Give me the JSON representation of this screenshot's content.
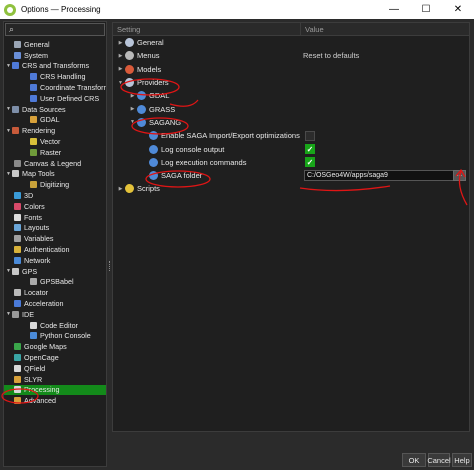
{
  "window": {
    "title": "Options — Processing",
    "minimize": "—",
    "maximize": "☐",
    "close": "✕"
  },
  "search": {
    "icon": "magnifier-icon",
    "glyph": "⌕"
  },
  "nav": [
    {
      "label": "General",
      "indent": 1,
      "color": "#9aa5b5"
    },
    {
      "label": "System",
      "indent": 1,
      "color": "#6a8fd8"
    },
    {
      "label": "CRS and Transforms",
      "indent": 0,
      "arrow": "▼",
      "color": "#4f7ad8"
    },
    {
      "label": "CRS Handling",
      "indent": 2,
      "color": "#4f7ad8"
    },
    {
      "label": "Coordinate Transforms",
      "indent": 2,
      "color": "#4f7ad8"
    },
    {
      "label": "User Defined CRS",
      "indent": 2,
      "color": "#4f7ad8"
    },
    {
      "label": "Data Sources",
      "indent": 0,
      "arrow": "▼",
      "color": "#7d8ea8"
    },
    {
      "label": "GDAL",
      "indent": 2,
      "color": "#d8a13a"
    },
    {
      "label": "Rendering",
      "indent": 0,
      "arrow": "▼",
      "color": "#c75a3a"
    },
    {
      "label": "Vector",
      "indent": 2,
      "color": "#d8c03a"
    },
    {
      "label": "Raster",
      "indent": 2,
      "color": "#6f9b3a"
    },
    {
      "label": "Canvas & Legend",
      "indent": 1,
      "color": "#8a8a8a"
    },
    {
      "label": "Map Tools",
      "indent": 0,
      "arrow": "▼",
      "color": "#c9c9c9"
    },
    {
      "label": "Digitizing",
      "indent": 2,
      "color": "#c9a23a"
    },
    {
      "label": "3D",
      "indent": 1,
      "color": "#3a9bd8"
    },
    {
      "label": "Colors",
      "indent": 1,
      "color": "#d84a6a"
    },
    {
      "label": "Fonts",
      "indent": 1,
      "color": "#dddddd"
    },
    {
      "label": "Layouts",
      "indent": 1,
      "color": "#6aa6d8"
    },
    {
      "label": "Variables",
      "indent": 1,
      "color": "#a0a0a0"
    },
    {
      "label": "Authentication",
      "indent": 1,
      "color": "#d8b23a"
    },
    {
      "label": "Network",
      "indent": 1,
      "color": "#4a8ad8"
    },
    {
      "label": "GPS",
      "indent": 0,
      "arrow": "▼",
      "color": "#c7c7c7"
    },
    {
      "label": "GPSBabel",
      "indent": 2,
      "color": "#aaaaaa"
    },
    {
      "label": "Locator",
      "indent": 1,
      "color": "#bbbbbb"
    },
    {
      "label": "Acceleration",
      "indent": 1,
      "color": "#4a7ad8"
    },
    {
      "label": "IDE",
      "indent": 0,
      "arrow": "▼",
      "color": "#999999"
    },
    {
      "label": "Code Editor",
      "indent": 2,
      "color": "#d8d8d8"
    },
    {
      "label": "Python Console",
      "indent": 2,
      "color": "#4a8ad8"
    },
    {
      "label": "Google Maps",
      "indent": 1,
      "color": "#3aa64a"
    },
    {
      "label": "OpenCage",
      "indent": 1,
      "color": "#3aa6a6"
    },
    {
      "label": "QField",
      "indent": 1,
      "color": "#d8d8d8"
    },
    {
      "label": "SLYR",
      "indent": 1,
      "color": "#d8a13a"
    },
    {
      "label": "Processing",
      "indent": 1,
      "color": "#d8d8d8",
      "selected": true
    },
    {
      "label": "Advanced",
      "indent": 1,
      "color": "#d8a13a"
    }
  ],
  "tree": {
    "header_setting": "Setting",
    "header_value": "Value",
    "rows": [
      {
        "label": "General",
        "indent": 0,
        "arrow": "▶",
        "icon": "gear-icon",
        "color": "#b8c4d8"
      },
      {
        "label": "Menus",
        "indent": 0,
        "arrow": "▶",
        "icon": "menu-icon",
        "color": "#b8b8b8",
        "value_text": "Reset to defaults"
      },
      {
        "label": "Models",
        "indent": 0,
        "arrow": "▶",
        "icon": "model-icon",
        "color": "#d85a3a"
      },
      {
        "label": "Providers",
        "indent": 0,
        "arrow": "▼",
        "icon": "gear-icon",
        "color": "#b8c4d8"
      },
      {
        "label": "GDAL",
        "indent": 1,
        "arrow": "▶",
        "icon": "gdal-icon",
        "color": "#4f8ad8"
      },
      {
        "label": "GRASS",
        "indent": 1,
        "arrow": "▶",
        "icon": "grass-icon",
        "color": "#4f8ad8"
      },
      {
        "label": "SAGANG",
        "indent": 1,
        "arrow": "▼",
        "icon": "saga-icon",
        "color": "#4f8ad8"
      },
      {
        "label": "Enable SAGA Import/Export optimizations",
        "indent": 2,
        "icon": "saga-icon",
        "color": "#4f8ad8",
        "check": false
      },
      {
        "label": "Log console output",
        "indent": 2,
        "icon": "saga-icon",
        "color": "#4f8ad8",
        "check": true
      },
      {
        "label": "Log execution commands",
        "indent": 2,
        "icon": "saga-icon",
        "color": "#4f8ad8",
        "check": true
      },
      {
        "label": "SAGA folder",
        "indent": 2,
        "icon": "saga-icon",
        "color": "#4f8ad8",
        "input": "C:/OSGeo4W/apps/saga9"
      },
      {
        "label": "Scripts",
        "indent": 0,
        "arrow": "▶",
        "icon": "python-icon",
        "color": "#e3c23a"
      }
    ],
    "checkmark": "✓",
    "browse_label": "..."
  },
  "buttons": {
    "ok": "OK",
    "cancel": "Cancel",
    "help": "Help"
  },
  "colors": {
    "selected_nav": "#138a1a",
    "checkbox_on": "#18a519",
    "annotation": "#e01515"
  }
}
